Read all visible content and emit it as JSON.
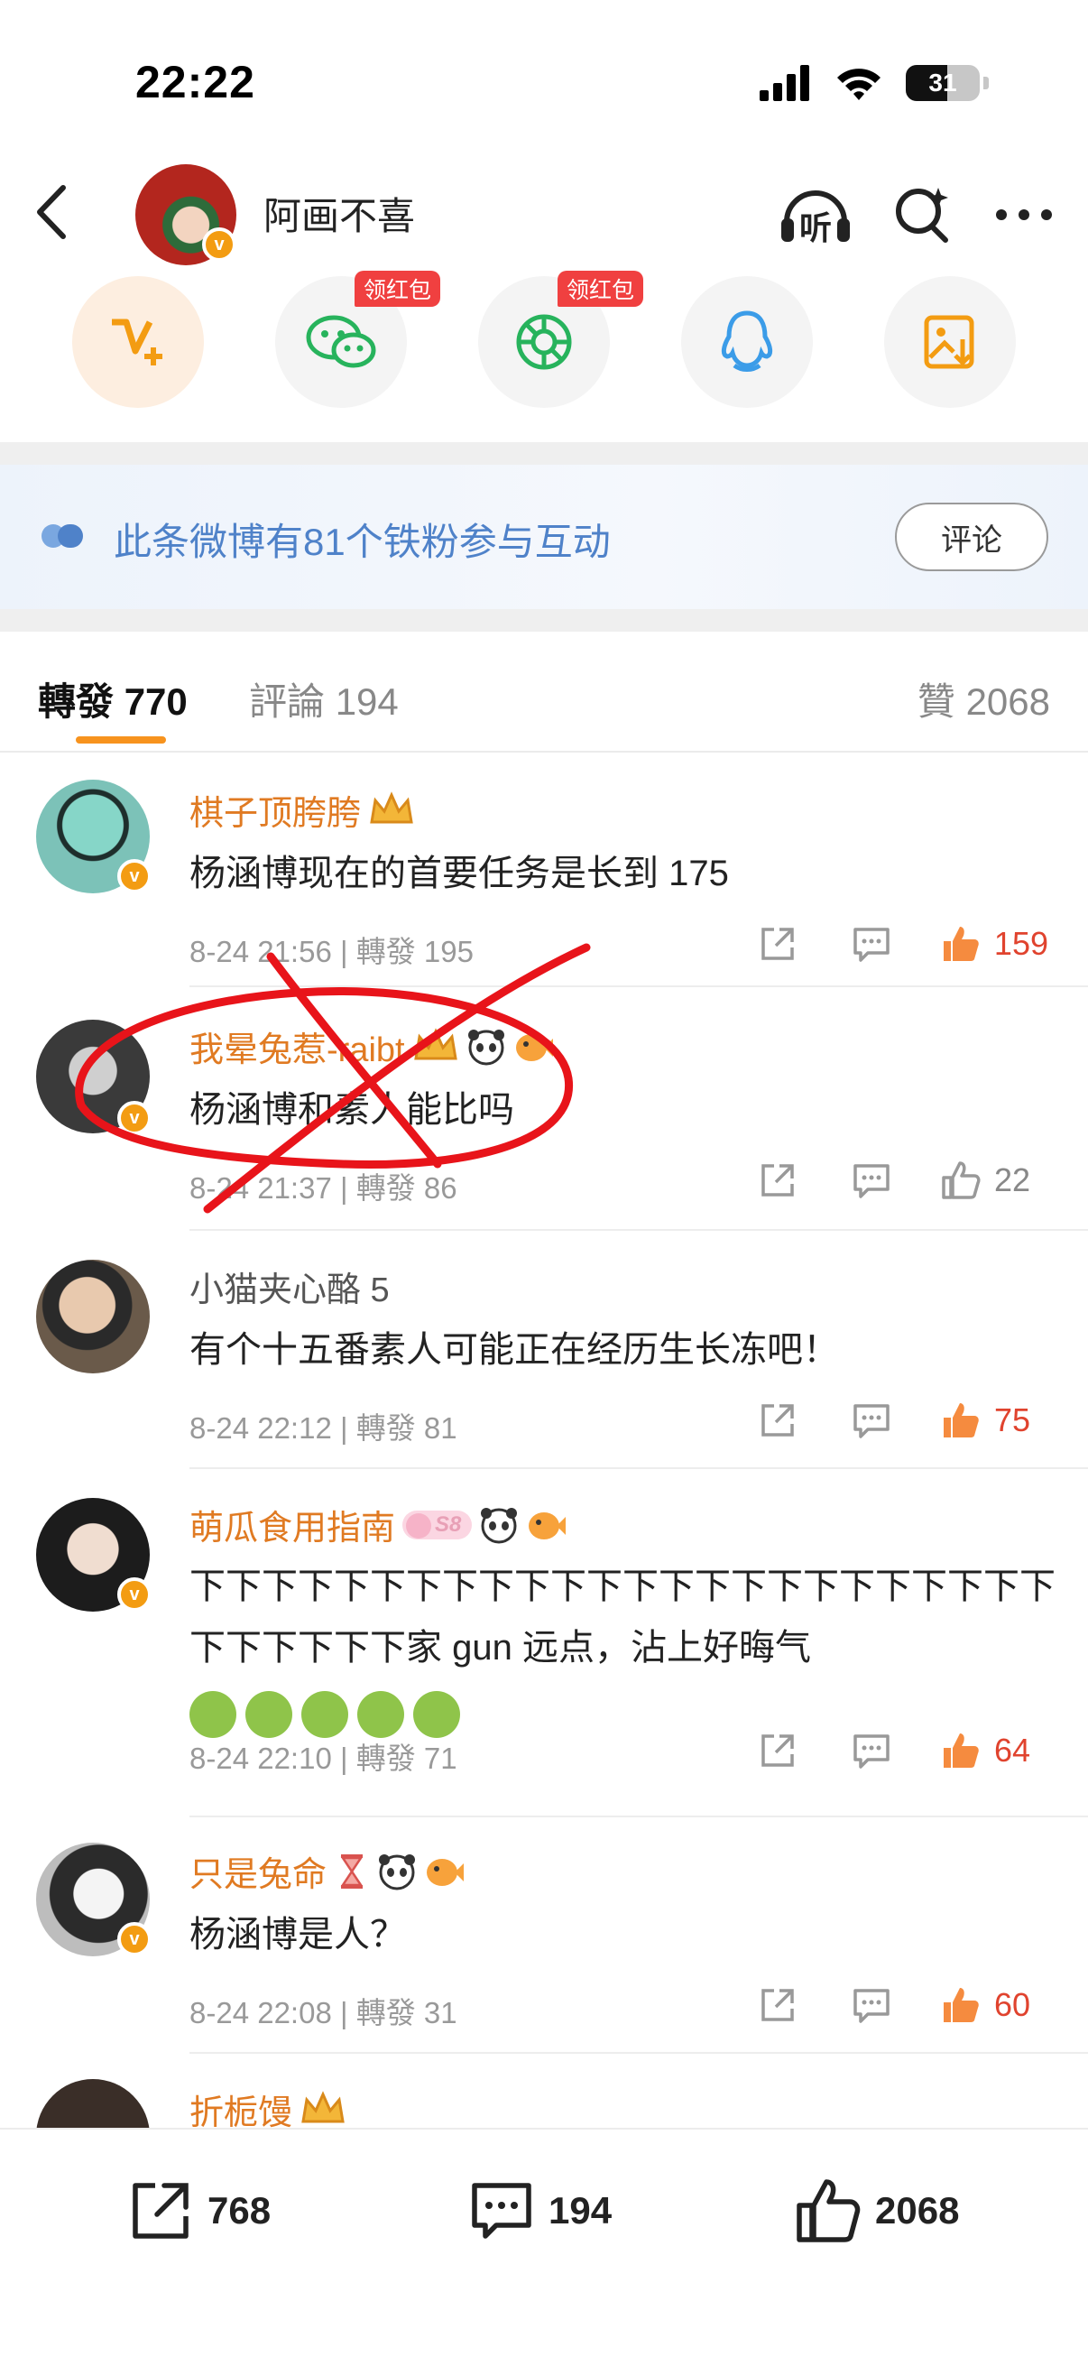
{
  "status_bar": {
    "time": "22:22",
    "battery": "31"
  },
  "header": {
    "title": "阿画不喜",
    "listen_label": "听"
  },
  "share": {
    "red_packet_label": "领红包"
  },
  "banner": {
    "text": "此条微博有81个铁粉参与互动",
    "button": "评论"
  },
  "tabs": {
    "repost": {
      "label": "轉發",
      "count": "770"
    },
    "comment": {
      "label": "評論",
      "count": "194"
    },
    "like": {
      "label": "贊",
      "count": "2068"
    }
  },
  "comments": [
    {
      "name": "棋子顶胯胯",
      "text": "杨涵博现在的首要任务是长到 175",
      "date": "8-24 21:56",
      "repost": "轉發 195",
      "likes": "159"
    },
    {
      "name": "我晕兔惹-raibt",
      "text": "杨涵博和素人能比吗",
      "date": "8-24 21:37",
      "repost": "轉發 86",
      "likes": "22"
    },
    {
      "name": "小猫夹心酪 5",
      "text": "有个十五番素人可能正在经历生长冻吧！",
      "date": "8-24 22:12",
      "repost": "轉發 81",
      "likes": "75"
    },
    {
      "name": "萌瓜食用指南",
      "badge_text": "S8",
      "text": "下下下下下下下下下下下下下下下下下下下下下下下下下下下下下下家 gun 远点，沾上好晦气",
      "date": "8-24 22:10",
      "repost": "轉發 71",
      "likes": "64"
    },
    {
      "name": "只是兔命",
      "text": "杨涵博是人？",
      "date": "8-24 22:08",
      "repost": "轉發 31",
      "likes": "60"
    },
    {
      "name": "折栀馒"
    }
  ],
  "bottom_bar": {
    "repost_count": "768",
    "comment_count": "194",
    "like_count": "2068"
  },
  "colors": {
    "accent_orange": "#f7931e",
    "name_orange": "#e07a22",
    "like_red": "#e0432e",
    "banner_blue": "#4f82c9",
    "scribble_red": "#e8141a"
  },
  "icons": [
    "back-icon",
    "headphone-icon",
    "search-icon",
    "more-icon",
    "vplus-icon",
    "wechat-icon",
    "moments-icon",
    "qq-icon",
    "save-image-icon",
    "share-icon",
    "comment-icon",
    "like-icon"
  ]
}
